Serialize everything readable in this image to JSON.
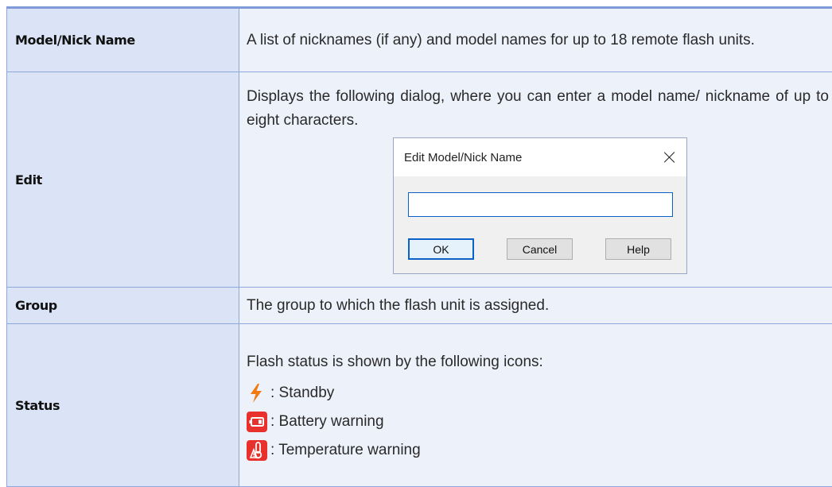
{
  "rows": {
    "model": {
      "term": "Model/Nick Name",
      "desc": "A list of nicknames (if any) and model names for up to 18 remote flash units."
    },
    "edit": {
      "term": "Edit",
      "desc": "Displays the following dialog, where you can enter a model name/ nickname of up to eight characters.",
      "dialog": {
        "title": "Edit Model/Nick Name",
        "close_icon": "close-x",
        "input_value": "",
        "buttons": {
          "ok": "OK",
          "cancel": "Cancel",
          "help": "Help"
        }
      }
    },
    "group": {
      "term": "Group",
      "desc": "The group to which the flash unit is assigned."
    },
    "status": {
      "term": "Status",
      "intro": "Flash status is shown by the following icons:",
      "items": [
        {
          "icon": "lightning-bolt-icon",
          "label": ": Standby"
        },
        {
          "icon": "battery-warning-icon",
          "label": ": Battery warning"
        },
        {
          "icon": "temperature-warning-icon",
          "label": ": Temperature warning"
        }
      ]
    }
  },
  "colors": {
    "term_bg": "#dbe4f6",
    "desc_bg": "#edf1fa",
    "border": "#8ea8de",
    "top_rule": "#7f9ad8",
    "standby_icon": "#f07a10",
    "warning_icon": "#e8312c"
  }
}
